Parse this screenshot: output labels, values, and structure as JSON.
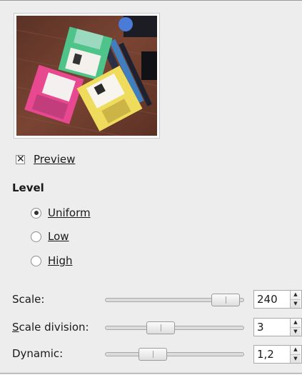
{
  "preview": {
    "checkbox_label": "Preview",
    "checked": true,
    "check_glyph": "✕"
  },
  "level": {
    "title": "Level",
    "options": [
      {
        "label": "Uniform",
        "selected": true
      },
      {
        "label": "Low",
        "selected": false
      },
      {
        "label": "High",
        "selected": false
      }
    ]
  },
  "sliders": [
    {
      "label": "Scale:",
      "value": "240"
    },
    {
      "label": "Scale division:",
      "value": "3"
    },
    {
      "label": "Dynamic:",
      "value": "1,2"
    }
  ],
  "spin_glyphs": {
    "up": "▲",
    "down": "▼"
  },
  "colors": {
    "background": "#ededed",
    "field": "#ffffff"
  }
}
